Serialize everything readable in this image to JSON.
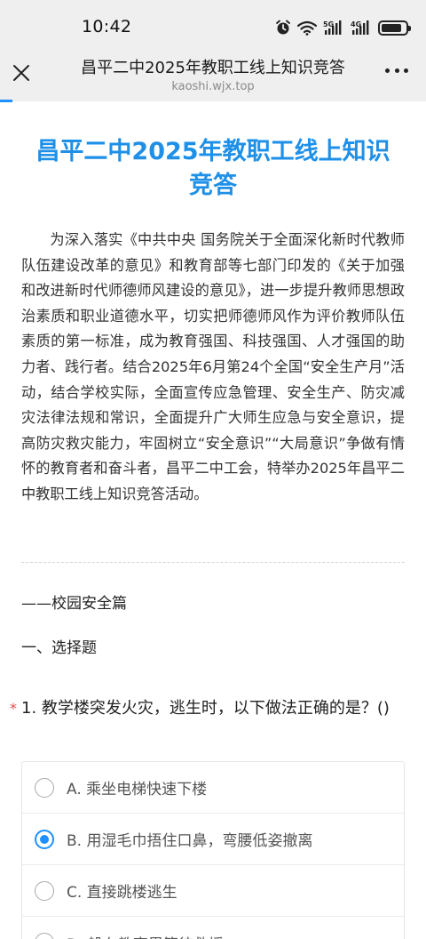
{
  "status_bar": {
    "time": "10:42",
    "icons": [
      "alarm-icon",
      "wifi-icon",
      "signal-5g-icon",
      "signal-4g-icon",
      "battery-icon"
    ],
    "net_label_1": "5G",
    "net_label_2": "4G"
  },
  "browser": {
    "title": "昌平二中2025年教职工线上知识竞答",
    "url": "kaoshi.wjx.top"
  },
  "survey": {
    "title": "昌平二中2025年教职工线上知识竞答",
    "intro": "为深入落实《中共中央 国务院关于全面深化新时代教师队伍建设改革的意见》和教育部等七部门印发的《关于加强和改进新时代师德师风建设的意见》，进一步提升教师思想政治素质和职业道德水平，切实把师德师风作为评价教师队伍素质的第一标准，成为教育强国、科技强国、人才强国的助力者、践行者。结合2025年6月第24个全国“安全生产月”活动，结合学校实际，全面宣传应急管理、安全生产、防灾减灾法律法规和常识，全面提升广大师生应急与安全意识，提高防灾救灾能力，牢固树立“安全意识”“大局意识”争做有情怀的教育者和奋斗者，昌平二中工会，特举办2025年昌平二中教职工线上知识竞答活动。",
    "section": "——校园安全篇",
    "subsection": "一、选择题",
    "question": {
      "required_mark": "*",
      "text": "1. 教学楼突发火灾，逃生时，以下做法正确的是？()",
      "options": [
        {
          "label": "A. 乘坐电梯快速下楼",
          "selected": false
        },
        {
          "label": "B. 用湿毛巾捂住口鼻，弯腰低姿撤离",
          "selected": true
        },
        {
          "label": "C. 直接跳楼逃生",
          "selected": false
        },
        {
          "label": "D. 躲在教室里等待救援",
          "selected": false
        }
      ]
    }
  },
  "colors": {
    "accent": "#1e90ff",
    "title": "#1e90e8",
    "required": "#e84a4a",
    "bar_bg": "#efefef"
  }
}
